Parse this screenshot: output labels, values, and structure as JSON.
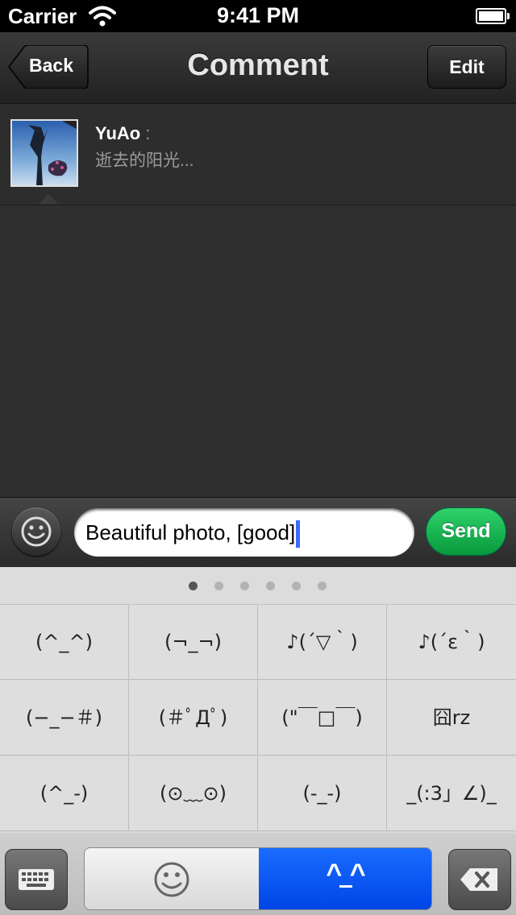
{
  "status_bar": {
    "carrier": "Carrier",
    "time": "9:41 PM"
  },
  "nav": {
    "back_label": "Back",
    "title": "Comment",
    "edit_label": "Edit"
  },
  "post": {
    "user": "YuAo",
    "colon": ":",
    "caption": "逝去的阳光..."
  },
  "composer": {
    "text": "Beautiful photo, [good]",
    "send_label": "Send"
  },
  "emoticon_panel": {
    "page_count": 6,
    "current_page": 1,
    "rows": [
      [
        "(^_^)",
        "(¬_¬)",
        "♪(´▽｀)",
        "♪(´ε｀)"
      ],
      [
        "(−_−＃)",
        "(＃ﾟДﾟ)",
        "(\"￣□￣)",
        "囧rz"
      ],
      [
        "(^_-)",
        "(⊙﹏⊙)",
        "(-_-)",
        "_(:3」∠)_"
      ]
    ]
  },
  "toolbar": {
    "kaomoji_tab_label": "^ ^",
    "active_tab": "kaomoji"
  },
  "colors": {
    "accent_blue": "#0a5cff",
    "send_green": "#1cc159",
    "nav_dark": "#2a2a2a"
  }
}
